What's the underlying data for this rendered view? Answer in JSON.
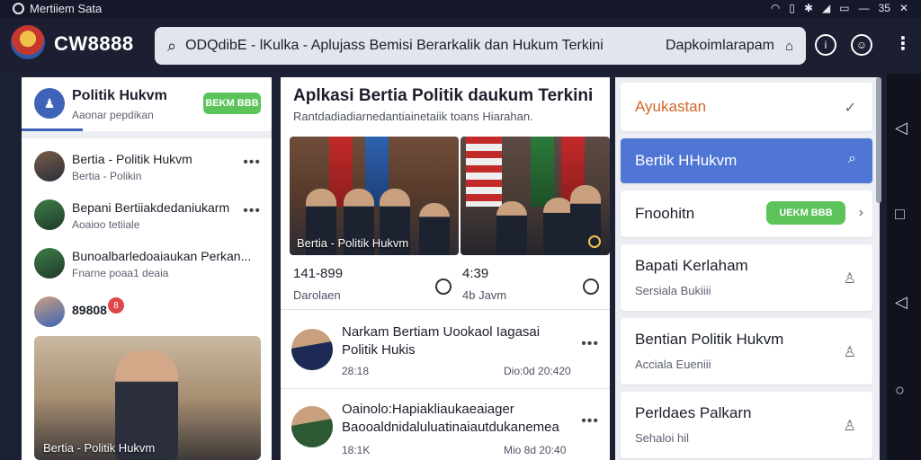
{
  "status_bar": {
    "app_name": "Mertiiem Sata",
    "time": "35"
  },
  "header": {
    "brand": "CW8888",
    "search_text": "ODQdibE - lKulka - Aplujass Bemisi Berarkalik dan Hukum Terkini",
    "search_suffix": "Dapkoimlarapam"
  },
  "left": {
    "profile": {
      "title": "Politik Hukvm",
      "subtitle": "Aaonar pepdikan",
      "pill": "BEKM BBB"
    },
    "items": [
      {
        "title": "Bertia - Politik Hukvm",
        "subtitle": "Bertia - Polikin"
      },
      {
        "title": "Bepani Bertiiakdedaniukarm",
        "subtitle": "Aoaioo tetiiale"
      },
      {
        "title": "Bunoalbarledoaiaukan Perkan...",
        "subtitle": "Fnarne poaa1 deaia"
      },
      {
        "title": "89808",
        "badge": "8"
      }
    ],
    "photo_caption": "Bertia - Politik Hukvm"
  },
  "middle": {
    "title": "Aplkasi Bertia Politik daukum Terkini",
    "subtitle": "Rantdadiadiarnedantiainetaiik toans Hiarahan.",
    "photo_caption": "Bertia - Politik Hukvm",
    "stat1": {
      "value": "141-899",
      "label": "Darolaen"
    },
    "stat2": {
      "value": "4:39",
      "label": "4b Javm"
    },
    "items": [
      {
        "title": "Narkam Bertiam Uookaol Iagasai Politik Hukis",
        "meta_left": "28:18",
        "meta_right": "Dio:0d 20:420"
      },
      {
        "title": "Oainolo:Hapiakliaukaeaiager Baooaldnidaluluatinaiautdukanemea",
        "meta_left": "18:1K",
        "meta_right": "Mio 8d 20:40"
      }
    ]
  },
  "right": {
    "cards": [
      {
        "title": "Ayukastan",
        "icon": "check-icon"
      },
      {
        "title": "Bertik HHukvm",
        "icon": "search-icon"
      },
      {
        "title": "Fnoohitn",
        "pill": "UEKM BBB",
        "icon": "chevron-right-icon"
      },
      {
        "title": "Bapati Kerlaham",
        "subtitle": "Sersiala Bukiiii",
        "icon": "user-icon"
      },
      {
        "title": "Bentian Politik Hukvm",
        "subtitle": "Acciala Eueniii",
        "icon": "user-icon"
      },
      {
        "title": "Perldaes Palkarn",
        "subtitle": "Sehaloi hil",
        "icon": "user-icon"
      }
    ]
  },
  "colors": {
    "accent": "#4f76d4",
    "green": "#5cc35b",
    "header": "#1b1f31",
    "badge": "#e0474c"
  }
}
